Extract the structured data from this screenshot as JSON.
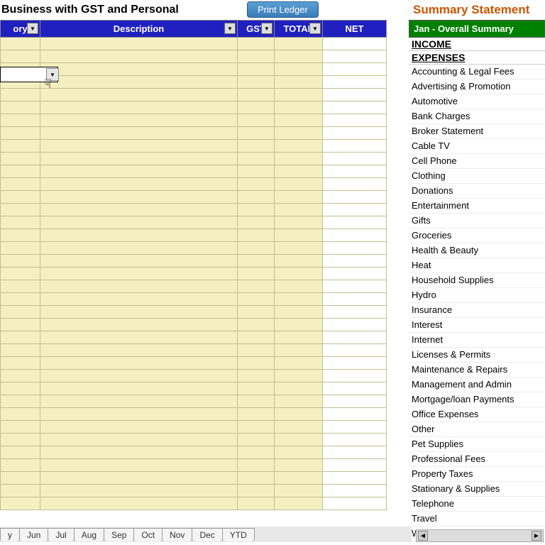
{
  "header": {
    "title_partial": "Business with GST and Personal",
    "print_button": "Print Ledger",
    "summary_title": "Summary Statement"
  },
  "ledger": {
    "columns": {
      "ory": "ory",
      "description": "Description",
      "gst": "GST",
      "total": "TOTAL",
      "net": "NET"
    }
  },
  "summary": {
    "period": "Jan - Overall Summary",
    "sections": {
      "income": "INCOME",
      "expenses": "EXPENSES"
    },
    "expense_items": [
      "Accounting & Legal Fees",
      "Advertising & Promotion",
      "Automotive",
      "Bank Charges",
      "Broker Statement",
      "Cable TV",
      "Cell Phone",
      "Clothing",
      "Donations",
      "Entertainment",
      "Gifts",
      "Groceries",
      "Health & Beauty",
      "Heat",
      "Household Supplies",
      "Hydro",
      "Insurance",
      "Interest",
      "Internet",
      "Licenses & Permits",
      "Maintenance & Repairs",
      "Management and Admin",
      "Mortgage/loan Payments",
      "Office Expenses",
      "Other",
      "Pet Supplies",
      "Professional Fees",
      "Property Taxes",
      "Stationary & Supplies",
      "Telephone",
      "Travel",
      "Water"
    ]
  },
  "tabs": [
    "y",
    "Jun",
    "Jul",
    "Aug",
    "Sep",
    "Oct",
    "Nov",
    "Dec",
    "YTD"
  ],
  "glyphs": {
    "down": "▼",
    "left": "◄",
    "right": "►",
    "cursor": "☟"
  }
}
